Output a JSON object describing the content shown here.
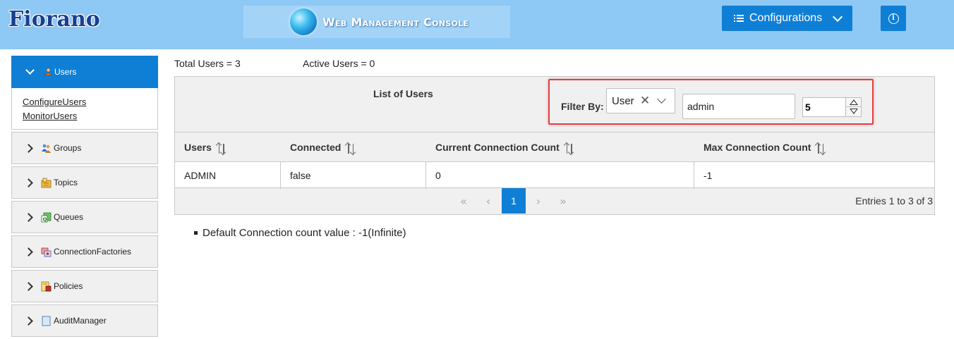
{
  "header": {
    "logo_text": "Fiorano",
    "console_title": "Web Management Console",
    "configurations_label": "Configurations",
    "info_icon": "info-icon"
  },
  "sidebar": {
    "items": [
      {
        "label": "Users",
        "icon": "user-icon",
        "expanded": true
      },
      {
        "label": "Groups",
        "icon": "group-icon"
      },
      {
        "label": "Topics",
        "icon": "topic-icon"
      },
      {
        "label": "Queues",
        "icon": "queue-icon"
      },
      {
        "label": "ConnectionFactories",
        "icon": "connection-factory-icon"
      },
      {
        "label": "Policies",
        "icon": "policy-icon"
      },
      {
        "label": "AuditManager",
        "icon": "audit-icon"
      }
    ],
    "sub_links": [
      "ConfigureUsers",
      "MonitorUsers"
    ]
  },
  "stats": {
    "total_users": "Total Users = 3",
    "active_users": "Active Users = 0"
  },
  "grid": {
    "title": "List of Users",
    "filter": {
      "label": "Filter By:",
      "field_value": "User",
      "search_value": "admin",
      "page_size": "5"
    },
    "columns": [
      "Users",
      "Connected",
      "Current Connection Count",
      "Max Connection Count"
    ],
    "rows": [
      [
        "ADMIN",
        "false",
        "0",
        "-1"
      ]
    ],
    "pager": {
      "first": "«",
      "prev": "‹",
      "current_page": "1",
      "next": "›",
      "last": "»",
      "entries": "Entries 1 to 3 of 3"
    }
  },
  "note": "Default Connection count value : -1(Infinite)",
  "colors": {
    "header_bg": "#8ec8f4",
    "primary": "#0f7fd6",
    "highlight_border": "#e04040"
  }
}
